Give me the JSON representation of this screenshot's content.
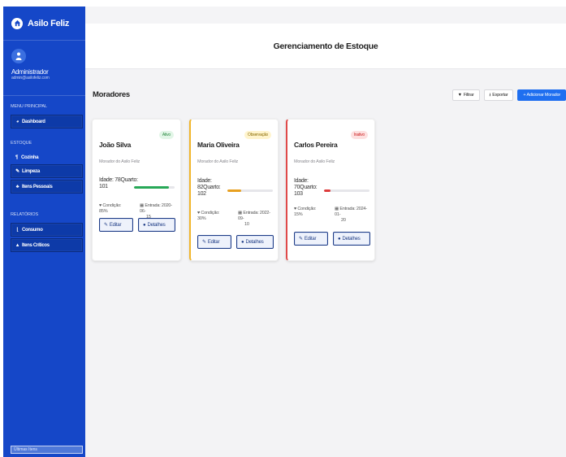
{
  "app": {
    "name": "Asilo Feliz"
  },
  "user": {
    "name": "Administrador",
    "email": "admin@asilofeliz.com"
  },
  "sidebar": {
    "menu_principal_label": "MENU PRINCIPAL",
    "dashboard": "Dashboard",
    "estoque_label": "ESTOQUE",
    "estoque_items": [
      "Cozinha",
      "Limpeza",
      "Itens Pessoais"
    ],
    "relatorios_label": "RELATÓRIOS",
    "relatorios_items": [
      "Consumo",
      "Itens Críticos"
    ],
    "footer": "Últimas Itens"
  },
  "header": {
    "title": "Gerenciamento de Estoque"
  },
  "section": {
    "title": "Moradores"
  },
  "toolbar": {
    "filter": "Filtrar",
    "export": "Exportar",
    "add": "+ Adicionar Morador"
  },
  "residents": [
    {
      "name": "João Silva",
      "status": "Ativo",
      "role": "Morador do Asilo Feliz",
      "info": "Idade: 78Quarto: 101",
      "condition_label": "Condição:",
      "condition_value": "85%",
      "entry_label": "Entrada: 2020-06-",
      "entry_value": "15",
      "progress": 0.85,
      "color": "#27a857",
      "edit": "Editar",
      "details": "Detalhes"
    },
    {
      "name": "Maria Oliveira",
      "status": "Observação",
      "role": "Morador do Asilo Feliz",
      "info": "Idade: 82Quarto: 102",
      "condition_label": "Condição:",
      "condition_value": "30%",
      "entry_label": "Entrada: 2022-09-",
      "entry_value": "10",
      "progress": 0.3,
      "color": "#e8a020",
      "edit": "Editar",
      "details": "Detalhes"
    },
    {
      "name": "Carlos Pereira",
      "status": "Inativo",
      "role": "Morador do Asilo Feliz",
      "info": "Idade: 70Quarto: 103",
      "condition_label": "Condição:",
      "condition_value": "15%",
      "entry_label": "Entrada: 2024-01-",
      "entry_value": "20",
      "progress": 0.15,
      "color": "#dd3b3b",
      "edit": "Editar",
      "details": "Detalhes"
    }
  ]
}
